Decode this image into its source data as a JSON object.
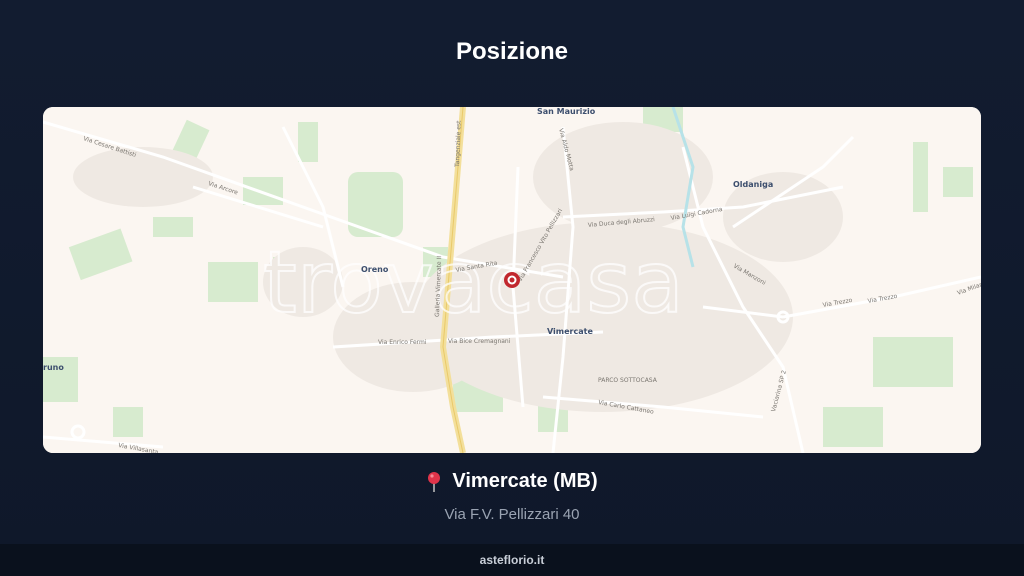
{
  "page": {
    "title": "Posizione"
  },
  "map": {
    "watermark": "trovacasa",
    "towns": {
      "san_maurizio": "San Maurizio",
      "oldaniga": "Oldaniga",
      "oreno": "Oreno",
      "vimercate": "Vimercate",
      "runo": "runo"
    },
    "streets": {
      "cesare_battisti": "Via Cesare Battisti",
      "arcore": "Via Arcore",
      "tangenziale": "Tangenziale est",
      "galleria": "Galleria Vimercate II",
      "aldo_motta": "Via Aldo Motta",
      "duca_abruzzi": "Via Duca degli Abruzzi",
      "luigi_cadorna": "Via Luigi Cadorna",
      "trezzo": "Via Trezzo",
      "trezzo2": "Via Trezzo",
      "milano": "Via Milano",
      "enrico_fermi": "Via Enrico Fermi",
      "bice_cremagnani": "Via Bice Cremagnani",
      "carlo_cattaneo": "Via Carlo Cattaneo",
      "villasanta": "Via Villasanta",
      "parco": "PARCO SOTTOCASA",
      "vaciarina": "Vaciarina SP 2",
      "pellizzari": "Via Francesco Vito Pellizzari",
      "santa_rita": "Via Santa Rita",
      "manzoni": "Via Manzoni"
    },
    "marker_icon": "location-marker-icon"
  },
  "location": {
    "icon": "pushpin-icon",
    "city": "Vimercate (MB)",
    "address": "Via F.V. Pellizzari 40"
  },
  "footer": {
    "site": "asteflorio.it"
  }
}
